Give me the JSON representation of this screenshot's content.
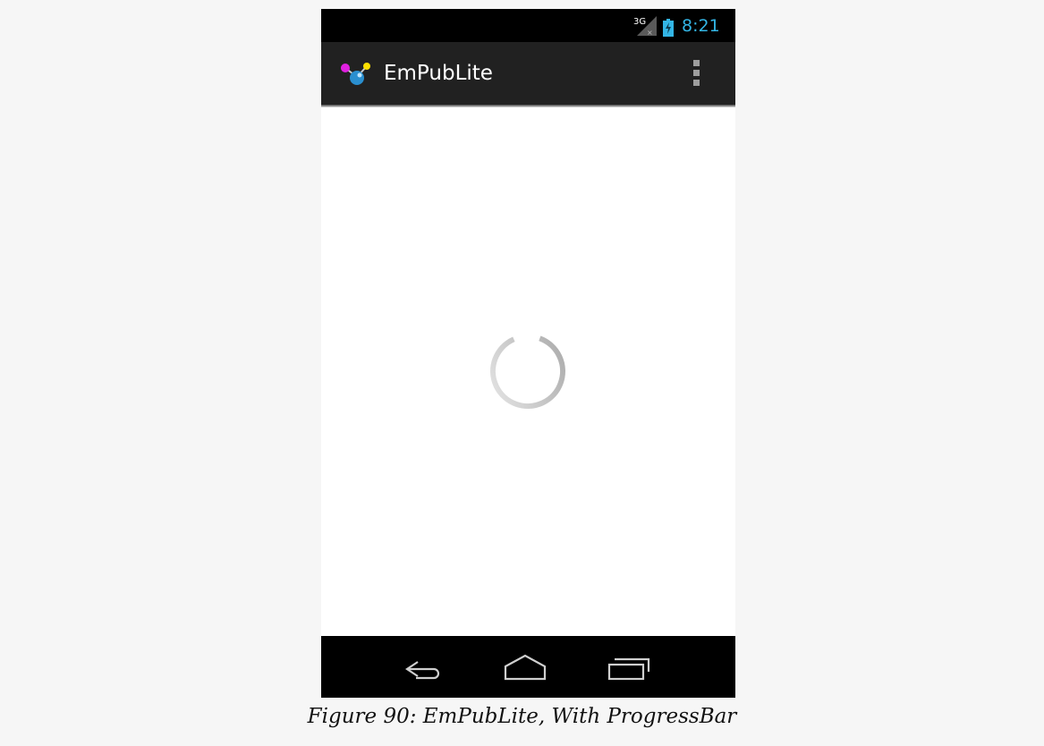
{
  "status_bar": {
    "network": "3G",
    "time": "8:21",
    "colors": {
      "accent": "#33b5e5",
      "background": "#000000"
    }
  },
  "action_bar": {
    "title": "EmPubLite",
    "logo_icon": "empublite-molecule-icon",
    "overflow_icon": "overflow-menu-icon",
    "background": "#212121"
  },
  "content": {
    "progress_indicator": "indeterminate-spinner",
    "background": "#ffffff"
  },
  "nav_bar": {
    "icons": [
      "back-icon",
      "home-icon",
      "recents-icon"
    ],
    "background": "#000000"
  },
  "caption": {
    "text": "Figure 90: EmPubLite, With ProgressBar"
  }
}
